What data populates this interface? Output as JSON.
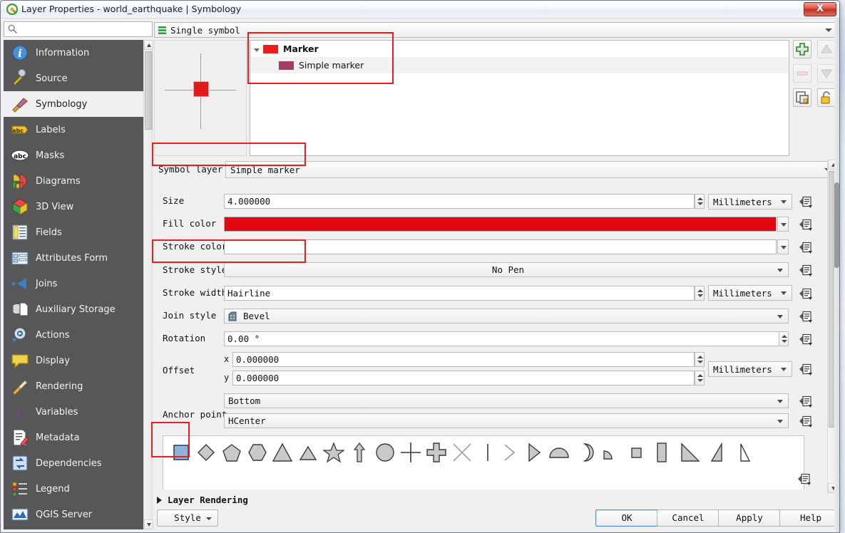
{
  "window": {
    "title": "Layer Properties - world_earthquake | Symbology",
    "app_icon": "qgis-logo-icon",
    "close_label": "X"
  },
  "search": {
    "placeholder": "",
    "value": "",
    "icon": "search-icon"
  },
  "sidebar": {
    "items": [
      {
        "label": "Information",
        "icon": "information-icon",
        "selected": false
      },
      {
        "label": "Source",
        "icon": "source-icon",
        "selected": false
      },
      {
        "label": "Symbology",
        "icon": "symbology-brush-icon",
        "selected": true
      },
      {
        "label": "Labels",
        "icon": "labels-abc-icon",
        "selected": false
      },
      {
        "label": "Masks",
        "icon": "masks-abc-icon",
        "selected": false
      },
      {
        "label": "Diagrams",
        "icon": "diagrams-icon",
        "selected": false
      },
      {
        "label": "3D View",
        "icon": "3d-view-cube-icon",
        "selected": false
      },
      {
        "label": "Fields",
        "icon": "fields-table-icon",
        "selected": false
      },
      {
        "label": "Attributes Form",
        "icon": "attributes-form-icon",
        "selected": false
      },
      {
        "label": "Joins",
        "icon": "joins-icon",
        "selected": false
      },
      {
        "label": "Auxiliary Storage",
        "icon": "auxiliary-storage-icon",
        "selected": false
      },
      {
        "label": "Actions",
        "icon": "actions-gear-icon",
        "selected": false
      },
      {
        "label": "Display",
        "icon": "display-balloon-icon",
        "selected": false
      },
      {
        "label": "Rendering",
        "icon": "rendering-broom-icon",
        "selected": false
      },
      {
        "label": "Variables",
        "icon": "variables-epsilon-icon",
        "selected": false
      },
      {
        "label": "Metadata",
        "icon": "metadata-pencil-icon",
        "selected": false
      },
      {
        "label": "Dependencies",
        "icon": "dependencies-arrows-icon",
        "selected": false
      },
      {
        "label": "Legend",
        "icon": "legend-icon",
        "selected": false
      },
      {
        "label": "QGIS Server",
        "icon": "qgis-server-icon",
        "selected": false
      }
    ]
  },
  "renderer": {
    "label": "Single symbol",
    "icon": "single-symbol-icon"
  },
  "symbol_tree": {
    "rows": [
      {
        "label": "Marker",
        "swatch": "#ee1c1c",
        "level": 0,
        "expanded": true
      },
      {
        "label": "Simple marker",
        "swatch": "#a33b62",
        "level": 1,
        "expanded": false
      }
    ]
  },
  "tree_buttons": [
    {
      "name": "add-symbol-layer-button",
      "icon": "plus-green-icon",
      "enabled": true
    },
    {
      "name": "move-up-button",
      "icon": "arrow-up-icon",
      "enabled": false
    },
    {
      "name": "remove-symbol-layer-button",
      "icon": "minus-red-icon",
      "enabled": false
    },
    {
      "name": "move-down-button",
      "icon": "arrow-down-icon",
      "enabled": false
    },
    {
      "name": "duplicate-layer-button",
      "icon": "copy-icon",
      "enabled": true
    },
    {
      "name": "lock-layer-button",
      "icon": "lock-open-icon",
      "enabled": true
    }
  ],
  "symbol_layer_type": {
    "label": "Symbol layer type",
    "value": "Simple marker"
  },
  "properties": [
    {
      "name": "size",
      "label": "Size",
      "value": "4.000000",
      "kind": "spin",
      "unit": "Millimeters"
    },
    {
      "name": "fill-color",
      "label": "Fill color",
      "value": "",
      "kind": "color",
      "color": "#e30613"
    },
    {
      "name": "stroke-color",
      "label": "Stroke color",
      "value": "",
      "kind": "color",
      "color": "#ffffff"
    },
    {
      "name": "stroke-style",
      "label": "Stroke style",
      "value": "No Pen",
      "kind": "combo-split"
    },
    {
      "name": "stroke-width",
      "label": "Stroke width",
      "value": "Hairline",
      "kind": "spin",
      "unit": "Millimeters"
    },
    {
      "name": "join-style",
      "label": "Join style",
      "value": "Bevel",
      "kind": "combo-icon",
      "icon": "bevel-join-icon"
    },
    {
      "name": "rotation",
      "label": "Rotation",
      "value": "0.00 °",
      "kind": "combo"
    },
    {
      "name": "offset",
      "label": "Offset",
      "value_x": "0.000000",
      "value_y": "0.000000",
      "sub_x": "x",
      "sub_y": "y",
      "kind": "offset",
      "unit": "Millimeters"
    },
    {
      "name": "anchor-point",
      "label": "Anchor point",
      "value_v": "Bottom",
      "value_h": "HCenter",
      "kind": "anchor"
    }
  ],
  "shape_palette": {
    "selected_index": 0,
    "shapes": [
      "square",
      "diamond",
      "pentagon",
      "hexagon",
      "triangle",
      "equilateral-triangle",
      "star",
      "arrow",
      "circle",
      "cross",
      "cross-fill",
      "cross2",
      "line",
      "arrow-head",
      "filled-arrow-head",
      "half-square",
      "quarter-circle",
      "quarter-square",
      "small-square",
      "tall-rectangle",
      "right-half-triangle",
      "left-half-triangle",
      "thin-triangle"
    ]
  },
  "layer_rendering": {
    "label": "Layer Rendering",
    "expanded": false
  },
  "footer": {
    "style_label": "Style",
    "ok_label": "OK",
    "cancel_label": "Cancel",
    "apply_label": "Apply",
    "help_label": "Help"
  },
  "highlights": {
    "accent": "#ee1c1c",
    "regions": [
      "symbol-tree-marker-group",
      "symbol-layer-type-row",
      "stroke-style-row",
      "selected-shape-square"
    ]
  }
}
